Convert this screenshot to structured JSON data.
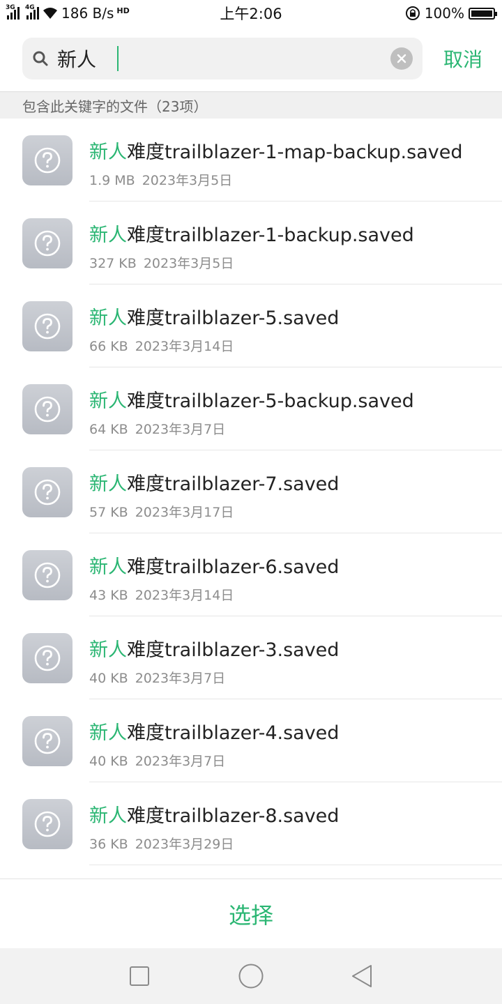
{
  "status_bar": {
    "network_1": "3G",
    "network_2": "4G",
    "speed": "186 B/s",
    "hd": "HD",
    "time": "上午2:06",
    "battery": "100%",
    "battery_level": 1.0
  },
  "search": {
    "query": "新人",
    "cancel_label": "取消"
  },
  "results_header": "包含此关键字的文件（23项）",
  "files": [
    {
      "highlight": "新人",
      "rest": "难度trailblazer-1-map-backup.saved",
      "size": "1.9 MB",
      "date": "2023年3月5日"
    },
    {
      "highlight": "新人",
      "rest": "难度trailblazer-1-backup.saved",
      "size": "327 KB",
      "date": "2023年3月5日"
    },
    {
      "highlight": "新人",
      "rest": "难度trailblazer-5.saved",
      "size": "66 KB",
      "date": "2023年3月14日"
    },
    {
      "highlight": "新人",
      "rest": "难度trailblazer-5-backup.saved",
      "size": "64 KB",
      "date": "2023年3月7日"
    },
    {
      "highlight": "新人",
      "rest": "难度trailblazer-7.saved",
      "size": "57 KB",
      "date": "2023年3月17日"
    },
    {
      "highlight": "新人",
      "rest": "难度trailblazer-6.saved",
      "size": "43 KB",
      "date": "2023年3月14日"
    },
    {
      "highlight": "新人",
      "rest": "难度trailblazer-3.saved",
      "size": "40 KB",
      "date": "2023年3月7日"
    },
    {
      "highlight": "新人",
      "rest": "难度trailblazer-4.saved",
      "size": "40 KB",
      "date": "2023年3月7日"
    },
    {
      "highlight": "新人",
      "rest": "难度trailblazer-8.saved",
      "size": "36 KB",
      "date": "2023年3月29日"
    }
  ],
  "file_icon": "unknown-file-icon",
  "bottom": {
    "select_label": "选择"
  },
  "nav": {
    "icons": [
      "recents-square-icon",
      "home-circle-icon",
      "back-triangle-icon"
    ]
  },
  "colors": {
    "accent": "#2bb673",
    "icon_bg": "#c3c6cc"
  }
}
